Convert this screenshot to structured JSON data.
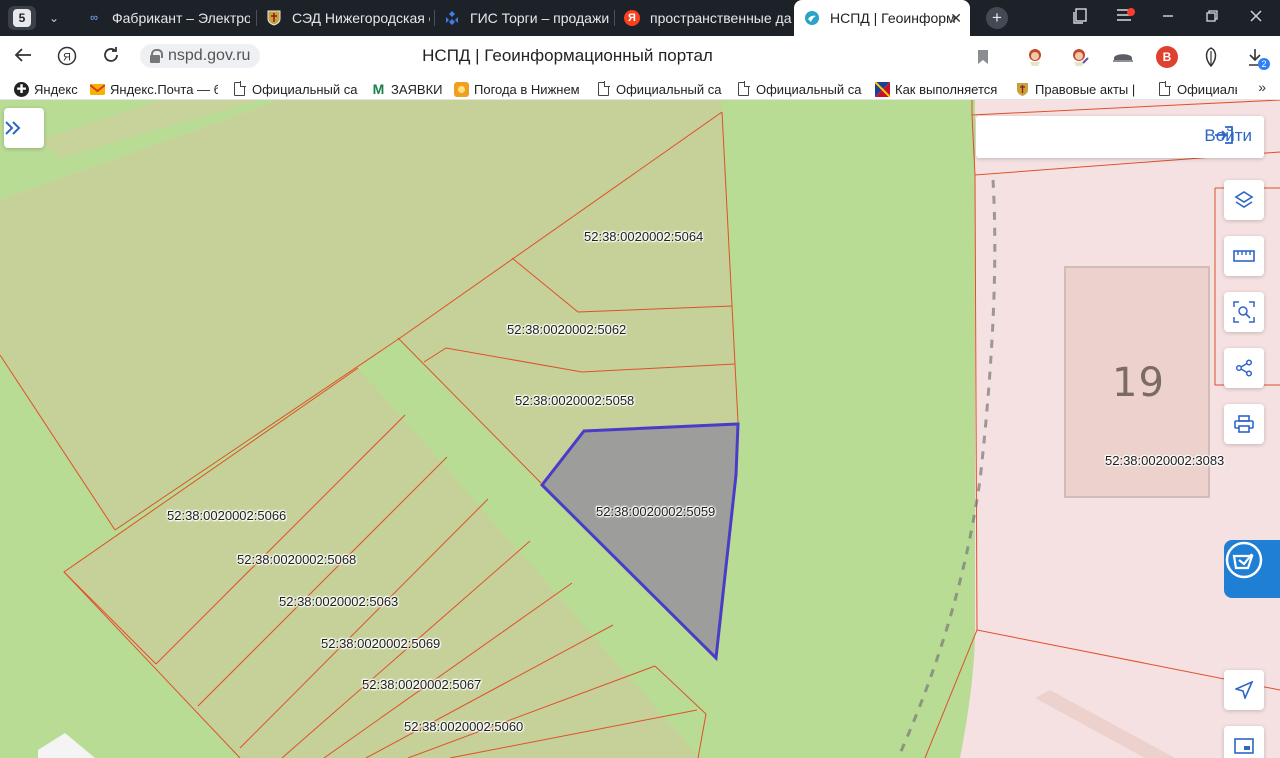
{
  "browser": {
    "tab_counter": "5",
    "tabs": [
      {
        "title": "Фабрикант – Электро",
        "icon": "infinity-icon"
      },
      {
        "title": "СЭД Нижегородская о",
        "icon": "coat-of-arms-icon"
      },
      {
        "title": "ГИС Торги – продажи",
        "icon": "emblem-icon"
      },
      {
        "title": "пространственные да",
        "icon": "yandex-icon"
      },
      {
        "title": "НСПД | Геоинформ",
        "icon": "nspd-icon",
        "active": true
      }
    ],
    "address": "nspd.gov.ru",
    "page_title": "НСПД | Геоинформационный портал",
    "download_count": "2",
    "bookmarks": [
      {
        "label": "Яндекс",
        "icon": "yandex-plus-icon"
      },
      {
        "label": "Яндекс.Почта — б",
        "icon": "mail-icon"
      },
      {
        "label": "Официальный са",
        "icon": "document-icon"
      },
      {
        "label": "ЗАЯВКИ",
        "icon": "m-logo-icon"
      },
      {
        "label": "Погода в Нижнем",
        "icon": "weather-icon"
      },
      {
        "label": "Официальный са",
        "icon": "document-icon"
      },
      {
        "label": "Официальный са",
        "icon": "document-icon"
      },
      {
        "label": "Как выполняется",
        "icon": "flag-icon"
      },
      {
        "label": "Правовые акты | ",
        "icon": "coat-of-arms-icon"
      },
      {
        "label": "Официальн",
        "icon": "document-icon"
      }
    ]
  },
  "map": {
    "login_label": "Войти",
    "building_number": "19",
    "selected_parcel": "52:38:0020002:5059",
    "parcels": [
      "52:38:0020002:5064",
      "52:38:0020002:5062",
      "52:38:0020002:5058",
      "52:38:0020002:5059",
      "52:38:0020002:5066",
      "52:38:0020002:5068",
      "52:38:0020002:5063",
      "52:38:0020002:5069",
      "52:38:0020002:5067",
      "52:38:0020002:5060",
      "52:38:0020002:3083"
    ],
    "tools": [
      "layers-icon",
      "ruler-icon",
      "search-area-icon",
      "share-icon",
      "print-icon",
      "locate-icon",
      "picture-in-picture-icon"
    ],
    "colors": {
      "parcel_fill": "#c9d39c",
      "boundary": "#e0502a",
      "selected_fill": "#9d9d9b",
      "selected_outline": "#4b3cc8",
      "urban_zone": "#f5e1e1",
      "accent": "#2e66c8"
    }
  }
}
